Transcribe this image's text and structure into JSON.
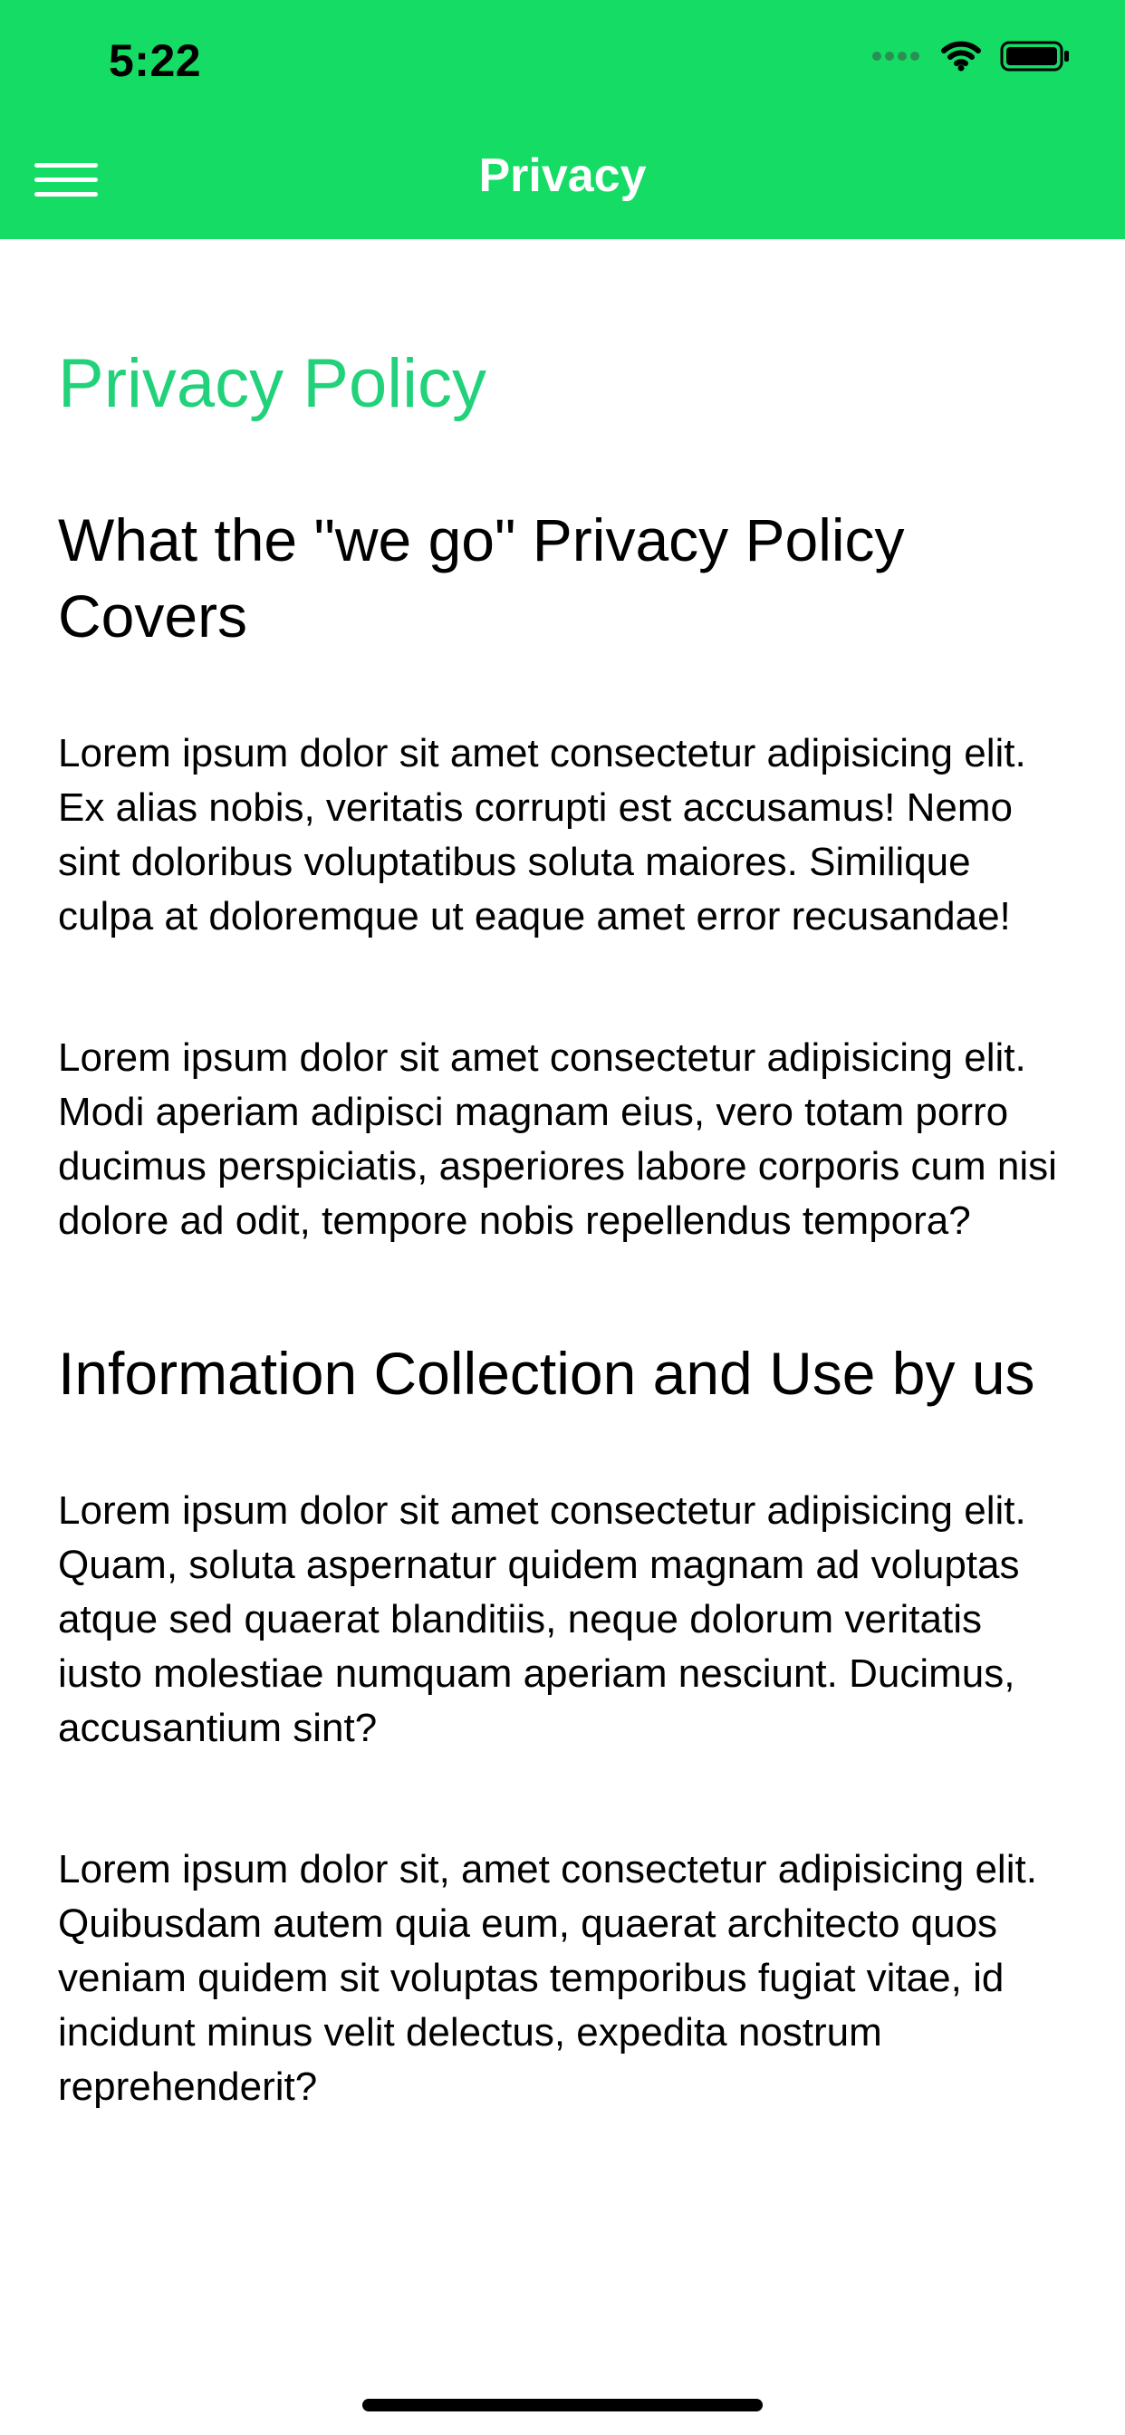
{
  "status_bar": {
    "time": "5:22",
    "icons": [
      "signal-dots-icon",
      "wifi-icon",
      "battery-icon"
    ]
  },
  "header": {
    "title": "Privacy",
    "menu_icon": "hamburger-menu-icon",
    "background_color": "#14DC64"
  },
  "content": {
    "page_title": "Privacy Policy",
    "accent_color": "#22D27A",
    "sections": [
      {
        "heading": "What the \"we go\" Privacy Policy Covers",
        "paragraphs": [
          "Lorem ipsum dolor sit amet consectetur adipisicing elit. Ex alias nobis, veritatis corrupti est accusamus! Nemo sint doloribus voluptatibus soluta maiores. Similique culpa at doloremque ut eaque amet error recusandae!",
          "Lorem ipsum dolor sit amet consectetur adipisicing elit. Modi aperiam adipisci magnam eius, vero totam porro ducimus perspiciatis, asperiores labore corporis cum nisi dolore ad odit, tempore nobis repellendus tempora?"
        ]
      },
      {
        "heading": "Information Collection and Use by us",
        "paragraphs": [
          "Lorem ipsum dolor sit amet consectetur adipisicing elit. Quam, soluta aspernatur quidem magnam ad voluptas atque sed quaerat blanditiis, neque dolorum veritatis iusto molestiae numquam aperiam nesciunt. Ducimus, accusantium sint?",
          "Lorem ipsum dolor sit, amet consectetur adipisicing elit. Quibusdam autem quia eum, quaerat architecto quos veniam quidem sit voluptas temporibus fugiat vitae, id incidunt minus velit delectus, expedita nostrum reprehenderit?"
        ]
      }
    ]
  }
}
